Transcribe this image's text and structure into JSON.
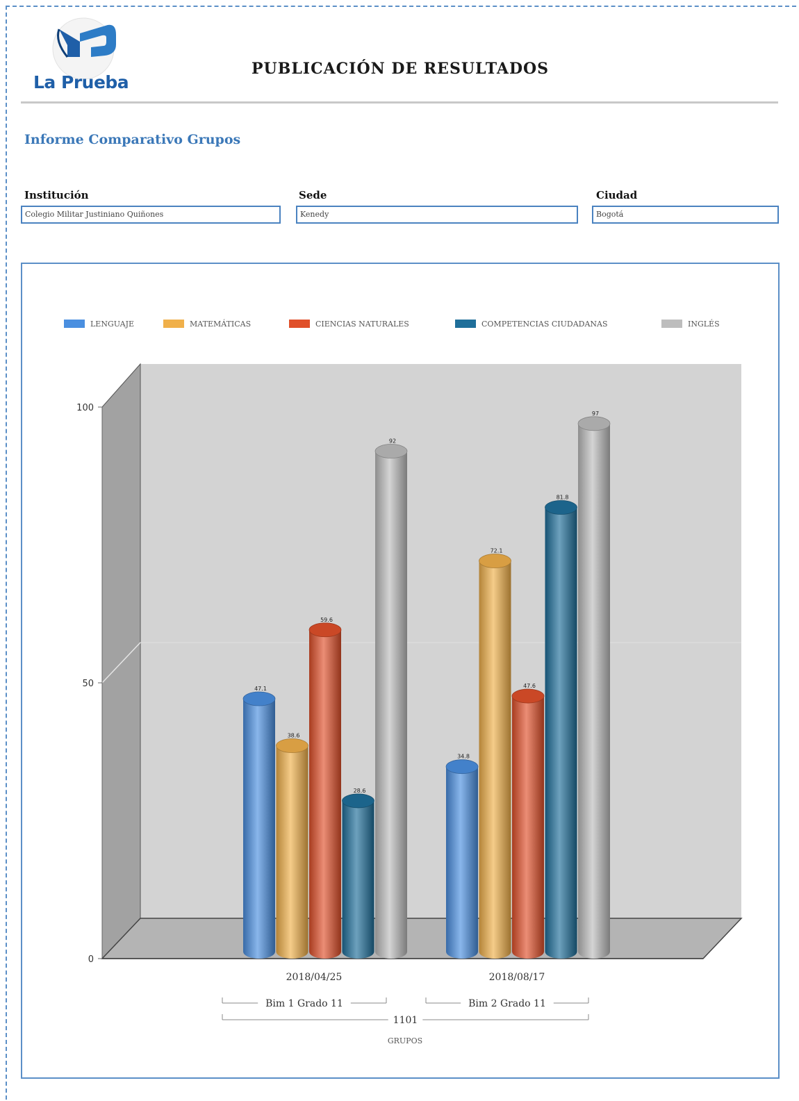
{
  "header": {
    "logo_text": "La Prueba",
    "title": "PUBLICACIÓN DE RESULTADOS"
  },
  "report": {
    "title": "Informe Comparativo Grupos"
  },
  "fields": {
    "institucion": {
      "label": "Institución",
      "value": "Colegio Militar Justiniano Quiñones"
    },
    "sede": {
      "label": "Sede",
      "value": "Kenedy"
    },
    "ciudad": {
      "label": "Ciudad",
      "value": "Bogotá"
    }
  },
  "colors": {
    "accent": "#3b78b8",
    "border": "#5b8fc7"
  },
  "chart_data": {
    "type": "bar",
    "categories": [
      "2018/04/25",
      "2018/08/17"
    ],
    "group_labels": [
      "Bim 1 Grado 11",
      "Bim 2 Grado 11"
    ],
    "outer_group": "1101",
    "xlabel": "GRUPOS",
    "ylim": [
      0,
      100
    ],
    "yticks": [
      0,
      50,
      100
    ],
    "legend_position": "top",
    "series": [
      {
        "name": "LENGUAJE",
        "color": "#4a8fe0",
        "values": [
          47.1,
          34.8
        ]
      },
      {
        "name": "MATEMÁTICAS",
        "color": "#f0b04a",
        "values": [
          38.6,
          72.1
        ]
      },
      {
        "name": "CIENCIAS NATURALES",
        "color": "#e0502a",
        "values": [
          59.6,
          47.6
        ]
      },
      {
        "name": "COMPETENCIAS CIUDADANAS",
        "color": "#1f6f9a",
        "values": [
          28.6,
          81.8
        ]
      },
      {
        "name": "INGLÉS",
        "color": "#bdbdbd",
        "values": [
          92,
          97
        ]
      }
    ]
  }
}
